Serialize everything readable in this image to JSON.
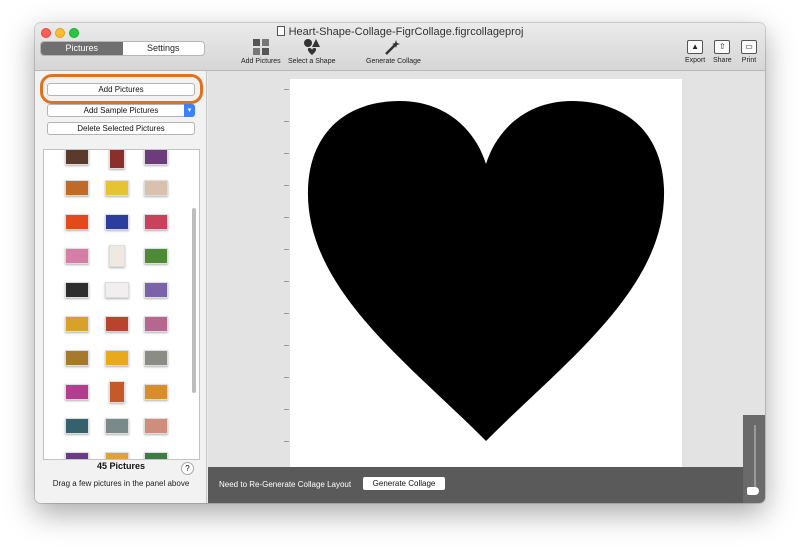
{
  "window": {
    "title": "Heart-Shape-Collage-FigrCollage.figrcollageproj"
  },
  "tabs": {
    "pictures": "Pictures",
    "settings": "Settings"
  },
  "toolbar": {
    "add_pictures": "Add Pictures",
    "select_shape": "Select a Shape",
    "generate_collage": "Generate Collage",
    "export": "Export",
    "share": "Share",
    "print": "Print"
  },
  "sidebar": {
    "add_pictures_button": "Add Pictures",
    "add_sample_button": "Add Sample Pictures",
    "delete_button": "Delete Selected Pictures",
    "picture_count": "45 Pictures",
    "help": "?",
    "hint": "Drag a few pictures in the panel above"
  },
  "bottom_bar": {
    "message": "Need to Re-Generate Collage Layout",
    "generate_button": "Generate Collage"
  },
  "colors": {
    "accent": "#3d82f5",
    "highlight_ring": "#e0711f",
    "heart": "#000000"
  },
  "icons": {
    "add_pictures": "grid-photos-icon",
    "select_shape": "shapes-icon",
    "generate_collage": "wand-icon",
    "export": "image-export-icon",
    "share": "share-icon",
    "print": "printer-icon"
  }
}
